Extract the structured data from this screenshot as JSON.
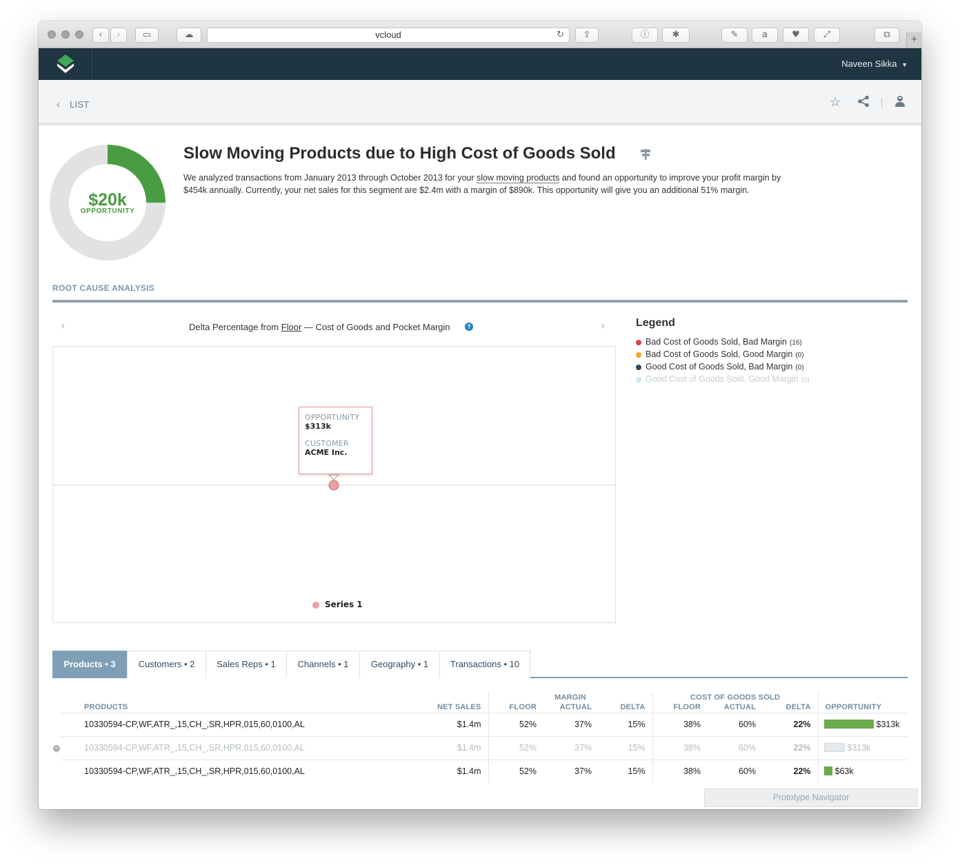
{
  "browser": {
    "url": "vcloud"
  },
  "app": {
    "user_name": "Naveen Sikka",
    "back_label": "LIST"
  },
  "opportunity": {
    "amount": "$20k",
    "label": "OPPORTUNITY",
    "fraction": 0.25
  },
  "page": {
    "title": "Slow Moving Products due to High Cost of Goods Sold",
    "desc_part1": "We analyzed transactions from January 2013 through October 2013 for your ",
    "desc_link": "slow moving products",
    "desc_part2": " and found an opportunity to improve your profit margin by $454k annually. Currently, your net sales for this segment are $2.4m with a margin of $890k. This opportunity will give you an additional 51% margin."
  },
  "rca": {
    "heading": "ROOT CAUSE ANALYSIS",
    "chart_title_part1": "Delta Percentage from ",
    "chart_title_link": "Floor",
    "chart_title_part2": " — Cost of Goods and Pocket Margin",
    "help": "?"
  },
  "chart_data": {
    "type": "scatter",
    "series": [
      {
        "name": "Series 1",
        "color": "#e8a0a3",
        "points": [
          {
            "x": 0,
            "y": 0
          }
        ]
      }
    ],
    "tooltip": {
      "label1": "OPPORTUNITY",
      "value1": "$313k",
      "label2": "CUSTOMER",
      "value2": "ACME Inc."
    }
  },
  "legend": {
    "title": "Legend",
    "items": [
      {
        "label": "Bad Cost of Goods Sold, Bad Margin",
        "count": "(16)",
        "color": "#e0404a"
      },
      {
        "label": "Bad Cost of Goods Sold, Good Margin",
        "count": "(0)",
        "color": "#f4a52c"
      },
      {
        "label": "Good Cost of Goods Sold, Bad Margin",
        "count": "(0)",
        "color": "#2b4656"
      },
      {
        "label": "Good Cost of Goods Sold, Good Margin",
        "count": "(0)",
        "color": "#cfe6f7"
      }
    ]
  },
  "tabs": [
    {
      "label": "Products • 3"
    },
    {
      "label": "Customers • 2"
    },
    {
      "label": "Sales Reps • 1"
    },
    {
      "label": "Channels • 1"
    },
    {
      "label": "Geography • 1"
    },
    {
      "label": "Transactions • 10"
    }
  ],
  "table": {
    "group_margin": "MARGIN",
    "group_cogs": "COST OF GOODS SOLD",
    "headers": [
      "PRODUCTS",
      "NET SALES",
      "FLOOR",
      "ACTUAL",
      "DELTA",
      "FLOOR",
      "ACTUAL",
      "DELTA",
      "OPPORTUNITY"
    ],
    "rows": [
      {
        "product": "10330594-CP,WF,ATR_,15,CH_,SR,HPR,015,60,0100,AL",
        "net_sales": "$1.4m",
        "m_floor": "52%",
        "m_actual": "37%",
        "m_delta": "15%",
        "c_floor": "38%",
        "c_actual": "60%",
        "c_delta": "22%",
        "opportunity": "$313k",
        "opp_fraction": 1.0
      },
      {
        "product": "10330594-CP,WF,ATR_,15,CH_,SR,HPR,015,60,0100,AL",
        "net_sales": "$1.4m",
        "m_floor": "52%",
        "m_actual": "37%",
        "m_delta": "15%",
        "c_floor": "38%",
        "c_actual": "60%",
        "c_delta": "22%",
        "opportunity": "$313k",
        "opp_fraction": 0.42
      },
      {
        "product": "10330594-CP,WF,ATR_,15,CH_,SR,HPR,015,60,0100,AL",
        "net_sales": "$1.4m",
        "m_floor": "52%",
        "m_actual": "37%",
        "m_delta": "15%",
        "c_floor": "38%",
        "c_actual": "60%",
        "c_delta": "22%",
        "opportunity": "$63k",
        "opp_fraction": 0.17
      }
    ]
  },
  "prototype_nav": "Prototype Navigator"
}
